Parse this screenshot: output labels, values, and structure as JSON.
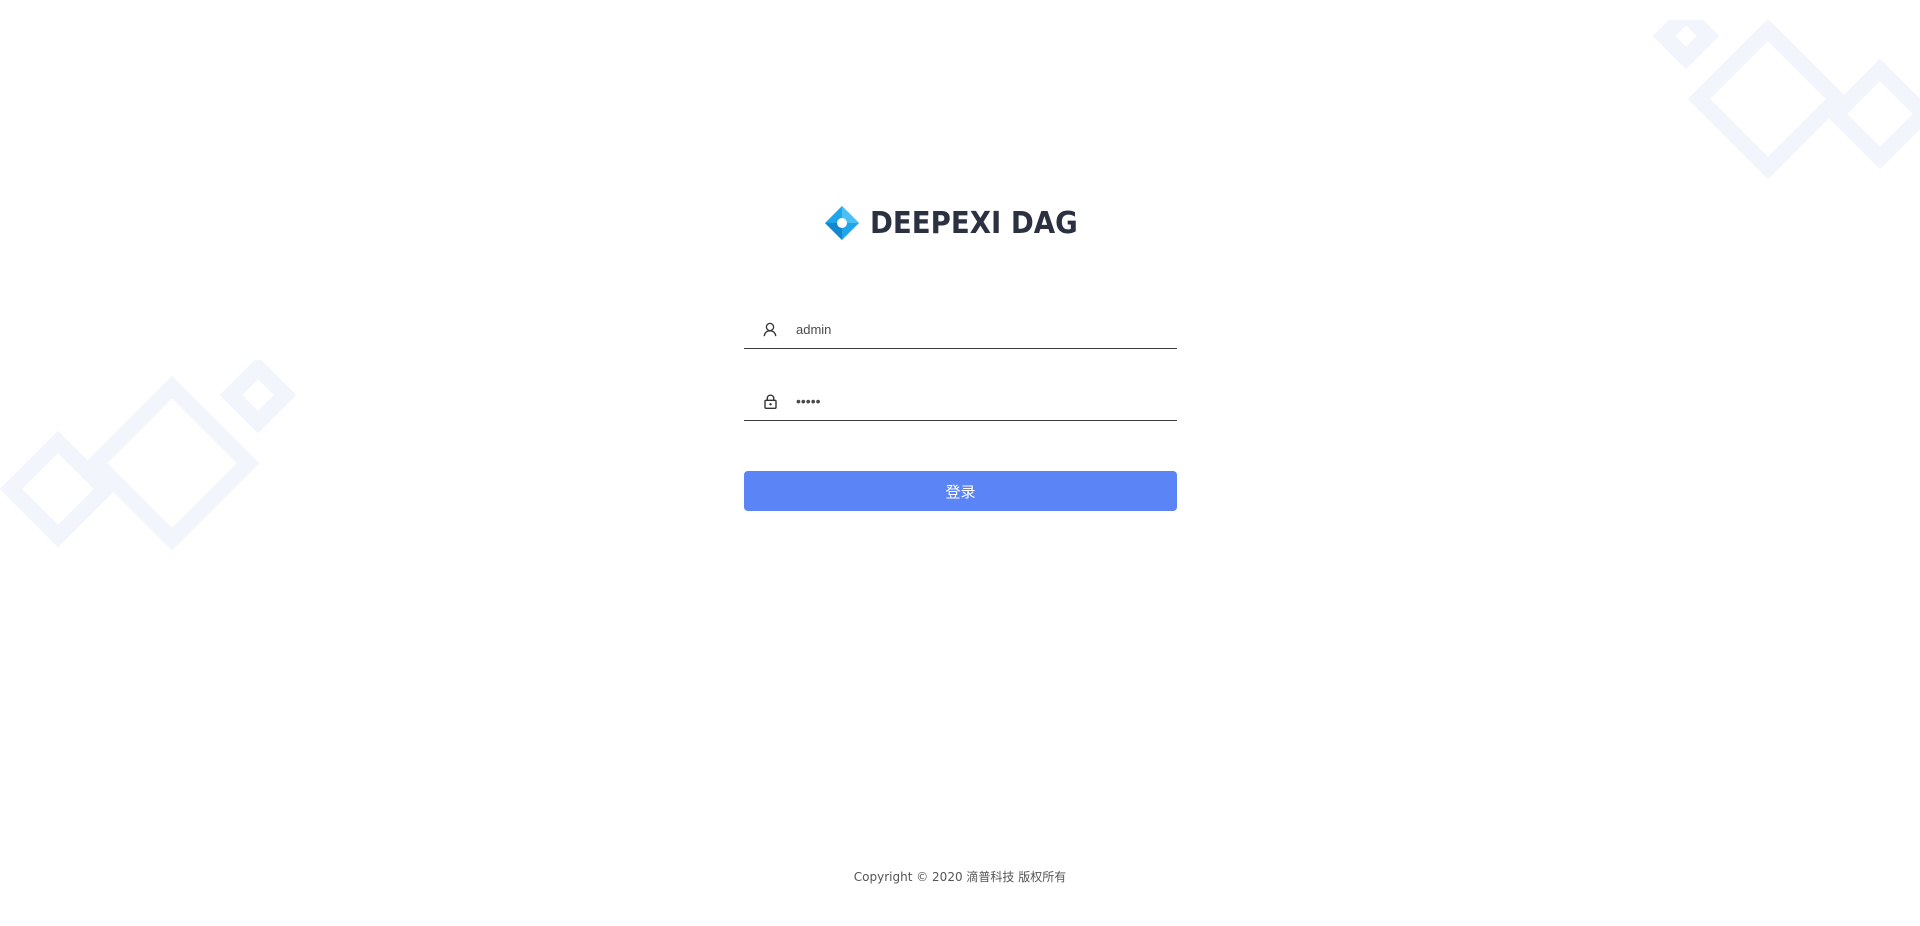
{
  "brand": {
    "name": "DEEPEXI DAG",
    "logo_icon": "diamond-logo-icon",
    "logo_color": "#1ea5ea",
    "text_color": "#2b3141"
  },
  "login_form": {
    "username": {
      "icon": "user-icon",
      "value": "admin"
    },
    "password": {
      "icon": "lock-icon",
      "value": "•••••"
    },
    "submit_label": "登录",
    "button_color": "#5b84f7"
  },
  "footer": {
    "copyright": "Copyright © 2020 滴普科技 版权所有"
  },
  "decoration": {
    "shape": "diamond-outline",
    "color": "#f3f5fd"
  }
}
